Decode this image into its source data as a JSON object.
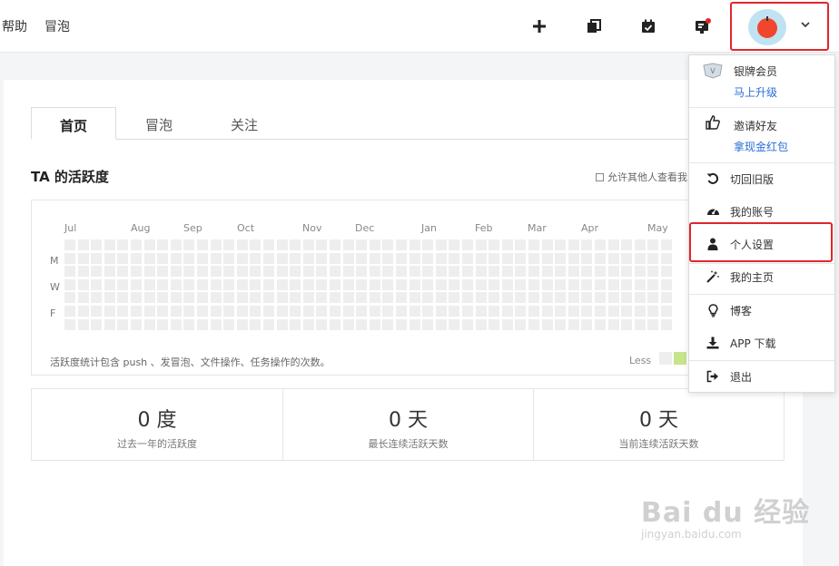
{
  "topbar": {
    "nav": [
      "帮助",
      "冒泡"
    ],
    "icons": [
      "plus-icon",
      "projects-icon",
      "calendar-check-icon",
      "notification-icon"
    ],
    "notification_dot_color": "#e0262c",
    "avatar_color": "#f0462d",
    "avatar_bg": "#bfe3f2"
  },
  "tabs": [
    {
      "label": "首页",
      "active": true
    },
    {
      "label": "冒泡",
      "active": false
    },
    {
      "label": "关注",
      "active": false
    }
  ],
  "activity": {
    "title": "TA 的活跃度",
    "allow_label": "允许其他人查看我",
    "months": [
      "Jul",
      "Aug",
      "Sep",
      "Oct",
      "Nov",
      "Dec",
      "Jan",
      "Feb",
      "Mar",
      "Apr",
      "May"
    ],
    "days": [
      "M",
      "W",
      "F"
    ],
    "footnote": "活跃度统计包含 push 、发冒泡、文件操作、任务操作的次数。",
    "legend_less": "Less",
    "legend_colors": [
      "#eeeeee",
      "#c6e48b"
    ]
  },
  "stats": [
    {
      "value": "0 度",
      "label": "过去一年的活跃度"
    },
    {
      "value": "0 天",
      "label": "最长连续活跃天数"
    },
    {
      "value": "0 天",
      "label": "当前连续活跃天数"
    }
  ],
  "menu": {
    "membership": {
      "label": "银牌会员",
      "action": "马上升级",
      "badge": "V"
    },
    "invite": {
      "label": "邀请好友",
      "action": "拿现金红包"
    },
    "items": [
      {
        "label": "切回旧版",
        "icon": "undo-icon"
      },
      {
        "label": "我的账号",
        "icon": "dashboard-icon"
      },
      {
        "label": "个人设置",
        "icon": "user-icon"
      },
      {
        "label": "我的主页",
        "icon": "magic-wand-icon"
      },
      {
        "label": "博客",
        "icon": "lightbulb-icon"
      },
      {
        "label": "APP 下载",
        "icon": "download-icon"
      },
      {
        "label": "退出",
        "icon": "sign-out-icon"
      }
    ]
  },
  "watermark": {
    "main": "Bai du 经验",
    "sub": "jingyan.baidu.com"
  }
}
